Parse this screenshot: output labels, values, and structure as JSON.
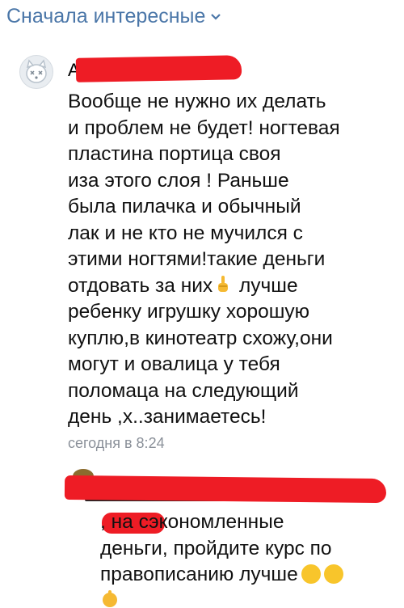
{
  "sort": {
    "label": "Сначала интересные",
    "icon": "chevron-down-icon"
  },
  "comments": [
    {
      "author_visible": "А",
      "text_before_emoji": "Вообще не нужно их делать\nи проблем не будет! ногтевая\nпластина портица своя\nиза этого слоя ! Раньше\nбыла пилачка и обычный\nлак и не кто не мучился с\nэтими ногтями!такие деньги\nотдовать за них",
      "text_after_emoji": " лучше\nребенку игрушку хорошую\nкуплю,в кинотеатр схожу,они\nмогут и овалица у тебя\nполомаца на следующий\nдень ,х..занимаетесь!",
      "inline_icon": "middle-finger-emoji-icon",
      "time": "сегодня в 8:24"
    },
    {
      "text": ", на сэкономленные\nденьги, пройдите курс по\nправописанию лучше",
      "icons": [
        "rofl-emoji-icon",
        "rofl-emoji-icon",
        "hand-emoji-icon"
      ]
    }
  ],
  "colors": {
    "accent": "#4a76a8",
    "redaction": "#ee1c25",
    "muted": "#8a9099"
  }
}
